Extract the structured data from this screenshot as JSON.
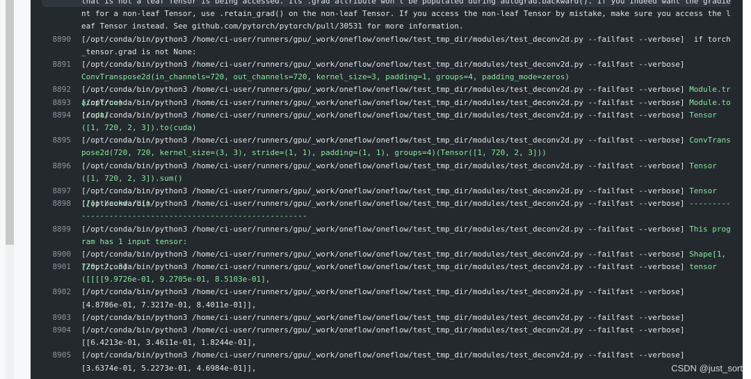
{
  "watermark": "CSDN @just_sort",
  "lines": [
    {
      "n": "",
      "cmd": "that is not a leaf Tensor is being accessed. Its .grad attribute won't be populated during autograd.backward(). If you indeed want the gradient for a non-leaf Tensor, use .retain_grad() on the non-leaf Tensor. If you access the non-leaf Tensor by mistake, make sure you access the leaf Tensor instead. See github.com/pytorch/pytorch/pull/30531 for more information.",
      "out": ""
    },
    {
      "n": "8890",
      "cmd": "[/opt/conda/bin/python3 /home/ci-user/runners/gpu/_work/oneflow/oneflow/test_tmp_dir/modules/test_deconv2d.py --failfast --verbose]  if torch_tensor.grad is not None:",
      "out": ""
    },
    {
      "n": "8891",
      "cmd": "[/opt/conda/bin/python3 /home/ci-user/runners/gpu/_work/oneflow/oneflow/test_tmp_dir/modules/test_deconv2d.py --failfast --verbose]",
      "out": "ConvTranspose2d(in_channels=720, out_channels=720, kernel_size=3, padding=1, groups=4, padding_mode=zeros)"
    },
    {
      "n": "8892",
      "cmd": "[/opt/conda/bin/python3 /home/ci-user/runners/gpu/_work/oneflow/oneflow/test_tmp_dir/modules/test_deconv2d.py --failfast --verbose] ",
      "out": "Module.train(True)"
    },
    {
      "n": "8893",
      "cmd": "[/opt/conda/bin/python3 /home/ci-user/runners/gpu/_work/oneflow/oneflow/test_tmp_dir/modules/test_deconv2d.py --failfast --verbose] ",
      "out": "Module.to(cuda)"
    },
    {
      "n": "8894",
      "cmd": "[/opt/conda/bin/python3 /home/ci-user/runners/gpu/_work/oneflow/oneflow/test_tmp_dir/modules/test_deconv2d.py --failfast --verbose] ",
      "out": "Tensor([1, 720, 2, 3]).to(cuda)"
    },
    {
      "n": "8895",
      "cmd": "[/opt/conda/bin/python3 /home/ci-user/runners/gpu/_work/oneflow/oneflow/test_tmp_dir/modules/test_deconv2d.py --failfast --verbose] ",
      "out": "ConvTranspose2d(720, 720, kernel_size=(3, 3), stride=(1, 1), padding=(1, 1), groups=4)(Tensor([1, 720, 2, 3]))"
    },
    {
      "n": "8896",
      "cmd": "[/opt/conda/bin/python3 /home/ci-user/runners/gpu/_work/oneflow/oneflow/test_tmp_dir/modules/test_deconv2d.py --failfast --verbose] ",
      "out": "Tensor([1, 720, 2, 3]).sum()"
    },
    {
      "n": "8897",
      "cmd": "[/opt/conda/bin/python3 /home/ci-user/runners/gpu/_work/oneflow/oneflow/test_tmp_dir/modules/test_deconv2d.py --failfast --verbose] ",
      "out": "Tensor([]).backward()"
    },
    {
      "n": "8898",
      "cmd": "[/opt/conda/bin/python3 /home/ci-user/runners/gpu/_work/oneflow/oneflow/test_tmp_dir/modules/test_deconv2d.py --failfast --verbose] ",
      "out": "----------------------------------------------------------"
    },
    {
      "n": "8899",
      "cmd": "[/opt/conda/bin/python3 /home/ci-user/runners/gpu/_work/oneflow/oneflow/test_tmp_dir/modules/test_deconv2d.py --failfast --verbose] ",
      "out": "This program has 1 input tensor:"
    },
    {
      "n": "8900",
      "cmd": "[/opt/conda/bin/python3 /home/ci-user/runners/gpu/_work/oneflow/oneflow/test_tmp_dir/modules/test_deconv2d.py --failfast --verbose] ",
      "out": "Shape[1, 720, 2, 3]"
    },
    {
      "n": "8901",
      "cmd": "[/opt/conda/bin/python3 /home/ci-user/runners/gpu/_work/oneflow/oneflow/test_tmp_dir/modules/test_deconv2d.py --failfast --verbose] ",
      "out": "tensor([[[[9.9726e-01, 9.2705e-01, 8.5103e-01],"
    },
    {
      "n": "8902",
      "cmd": "[/opt/conda/bin/python3 /home/ci-user/runners/gpu/_work/oneflow/oneflow/test_tmp_dir/modules/test_deconv2d.py --failfast --verbose]           [4.8786e-01, 7.3217e-01, 8.4011e-01]],",
      "out": ""
    },
    {
      "n": "8903",
      "cmd": "[/opt/conda/bin/python3 /home/ci-user/runners/gpu/_work/oneflow/oneflow/test_tmp_dir/modules/test_deconv2d.py --failfast --verbose]",
      "out": ""
    },
    {
      "n": "8904",
      "cmd": "[/opt/conda/bin/python3 /home/ci-user/runners/gpu/_work/oneflow/oneflow/test_tmp_dir/modules/test_deconv2d.py --failfast --verbose]          [[6.4213e-01, 3.4611e-01, 1.8244e-01],",
      "out": ""
    },
    {
      "n": "8905",
      "cmd": "[/opt/conda/bin/python3 /home/ci-user/runners/gpu/_work/oneflow/oneflow/test_tmp_dir/modules/test_deconv2d.py --failfast --verbose]           [3.6374e-01, 5.2273e-01, 4.6984e-01]],",
      "out": ""
    }
  ]
}
